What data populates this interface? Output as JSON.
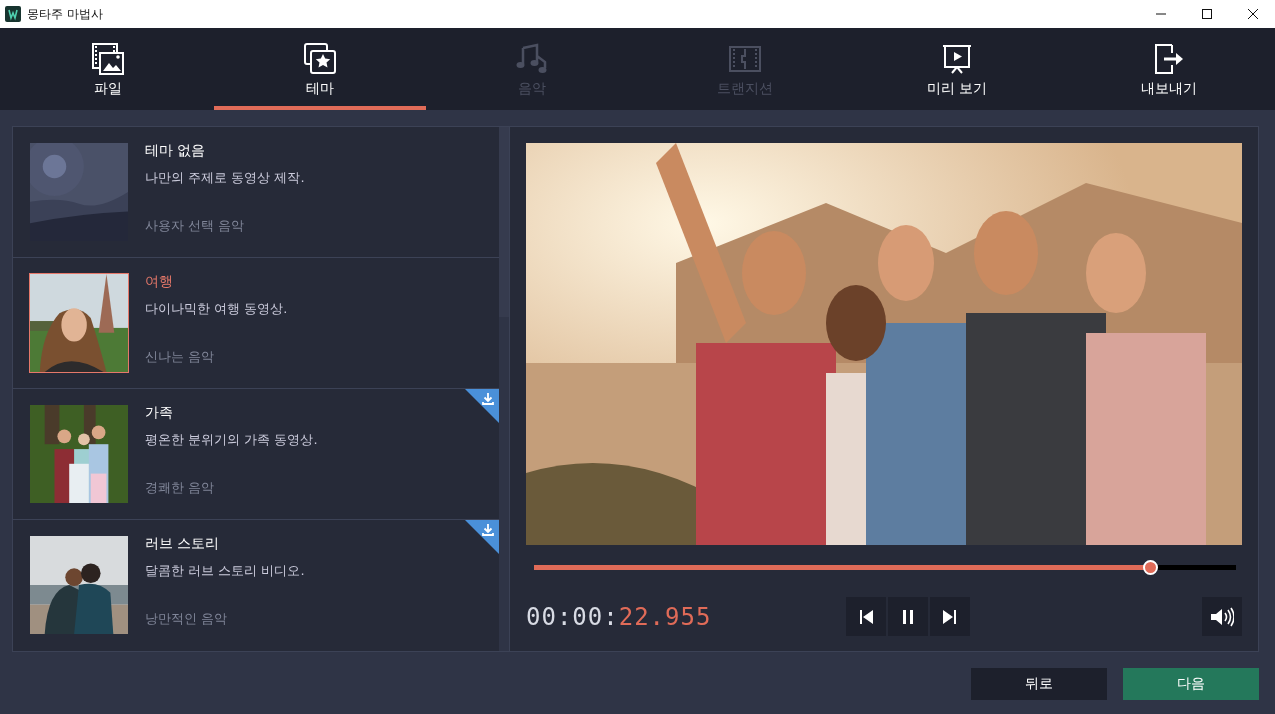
{
  "window": {
    "title": "몽타주 마법사"
  },
  "tabs": [
    {
      "label": "파일",
      "kind": "file",
      "selected": false,
      "disabled": false
    },
    {
      "label": "테마",
      "kind": "theme",
      "selected": true,
      "disabled": false
    },
    {
      "label": "음악",
      "kind": "music",
      "selected": false,
      "disabled": true
    },
    {
      "label": "트랜지션",
      "kind": "transition",
      "selected": false,
      "disabled": true
    },
    {
      "label": "미리 보기",
      "kind": "preview",
      "selected": false,
      "disabled": false
    },
    {
      "label": "내보내기",
      "kind": "export",
      "selected": false,
      "disabled": false
    }
  ],
  "themes": [
    {
      "title": "테마 없음",
      "description": "나만의 주제로 동영상 제작.",
      "music": "사용자 선택 음악",
      "kind": "blank",
      "selected": false,
      "download": false
    },
    {
      "title": "여행",
      "description": "다이나믹한 여행 동영상.",
      "music": "신나는 음악",
      "kind": "travel",
      "selected": true,
      "download": false
    },
    {
      "title": "가족",
      "description": "평온한 분위기의 가족 동영상.",
      "music": "경쾌한 음악",
      "kind": "family",
      "selected": false,
      "download": true
    },
    {
      "title": "러브 스토리",
      "description": "달콤한 러브 스토리 비디오.",
      "music": "낭만적인 음악",
      "kind": "love",
      "selected": false,
      "download": true
    }
  ],
  "player": {
    "level": 0.877,
    "time_elapsed": "00:00:",
    "time_fraction": "22.955"
  },
  "buttons": {
    "back": "뒤로",
    "next": "다음"
  }
}
